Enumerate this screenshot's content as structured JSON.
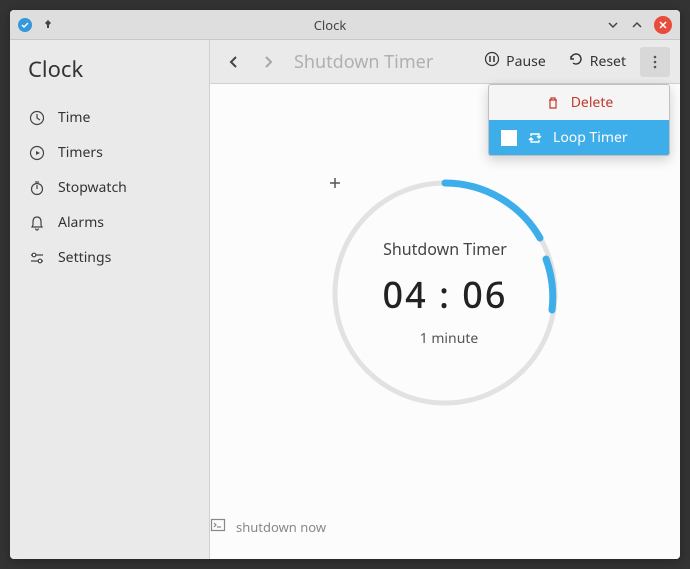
{
  "window": {
    "title": "Clock"
  },
  "sidebar": {
    "header": "Clock",
    "items": [
      {
        "label": "Time"
      },
      {
        "label": "Timers"
      },
      {
        "label": "Stopwatch"
      },
      {
        "label": "Alarms"
      },
      {
        "label": "Settings"
      }
    ]
  },
  "toolbar": {
    "title": "Shutdown Timer",
    "pause": "Pause",
    "reset": "Reset"
  },
  "timer": {
    "name": "Shutdown Timer",
    "time": "04 : 06",
    "add_minute": "1 minute",
    "command": "shutdown now"
  },
  "menu": {
    "delete": "Delete",
    "loop": "Loop Timer"
  }
}
